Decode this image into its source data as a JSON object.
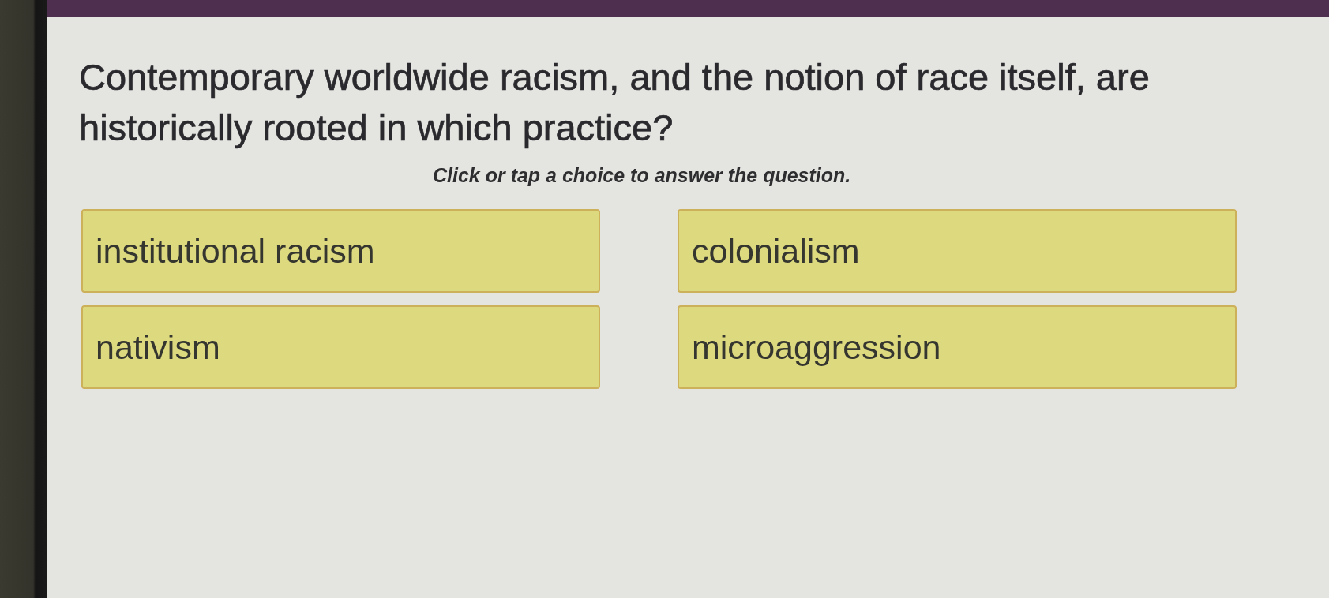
{
  "question": {
    "text": "Contemporary worldwide racism, and the notion of race itself, are historically rooted in which practice?",
    "instruction": "Click or tap a choice to answer the question."
  },
  "choices": [
    {
      "label": "institutional racism",
      "selected": false
    },
    {
      "label": "colonialism",
      "selected": false
    },
    {
      "label": "nativism",
      "selected": false
    },
    {
      "label": "microaggression",
      "selected": false
    }
  ]
}
